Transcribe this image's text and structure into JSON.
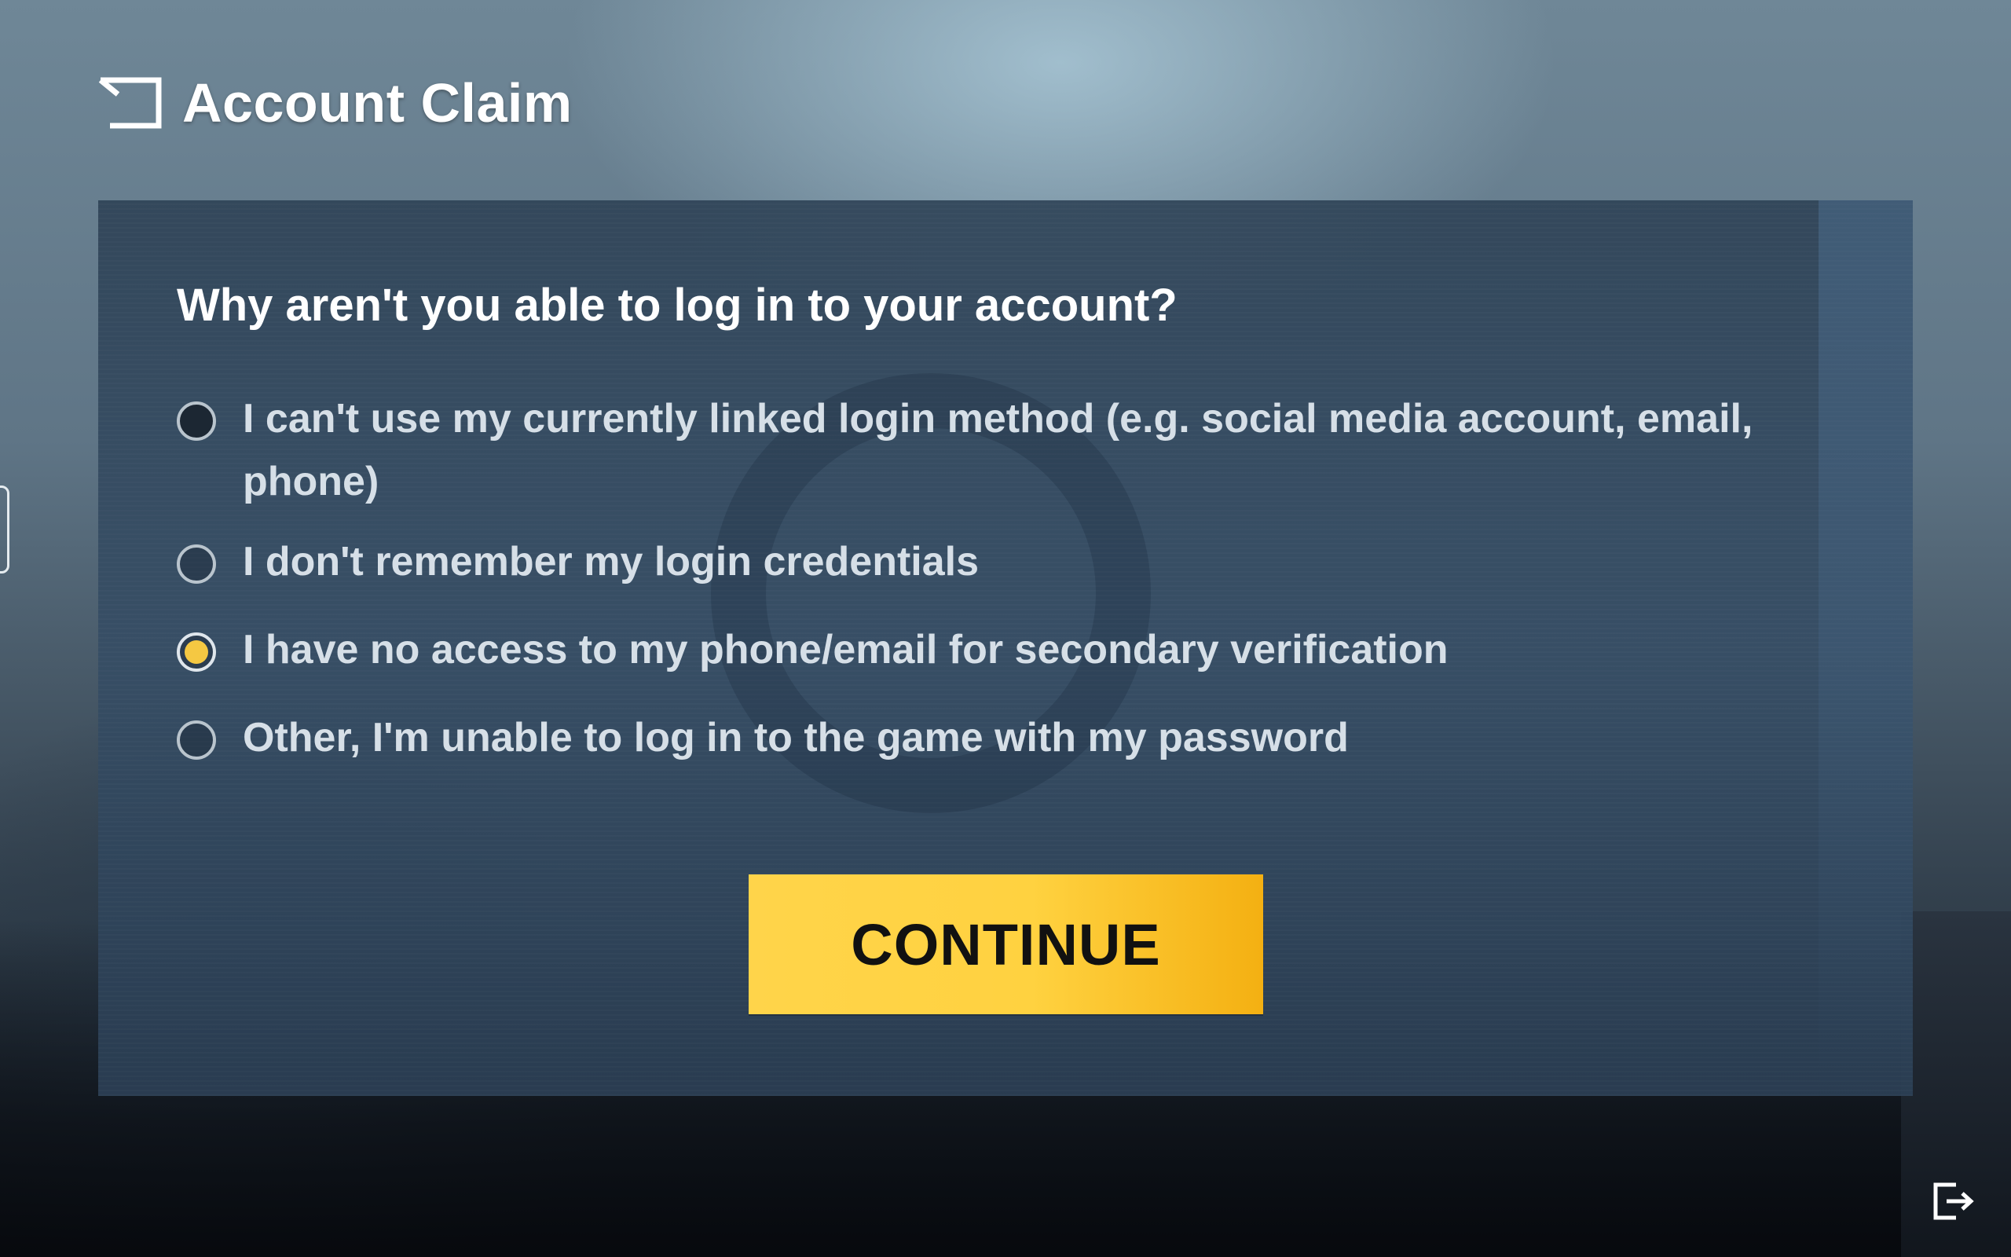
{
  "header": {
    "title": "Account Claim",
    "back_icon": "back-arrow-icon"
  },
  "form": {
    "question": "Why aren't you able to log in to your account?",
    "options": [
      {
        "label": "I can't use my currently linked login method (e.g. social media account, email, phone)",
        "selected": false
      },
      {
        "label": "I don't remember my login credentials",
        "selected": false
      },
      {
        "label": "I have no access to my phone/email for secondary verification",
        "selected": true
      },
      {
        "label": "Other, I'm unable to log in to the game with my password",
        "selected": false
      }
    ],
    "continue_label": "CONTINUE"
  },
  "footer": {
    "exit_icon": "exit-icon"
  },
  "colors": {
    "accent": "#f5c842",
    "button_start": "#ffd44a",
    "button_end": "#f4b012",
    "panel": "#2e4358",
    "text_primary": "#ffffff",
    "text_secondary": "#d6dfe7"
  }
}
